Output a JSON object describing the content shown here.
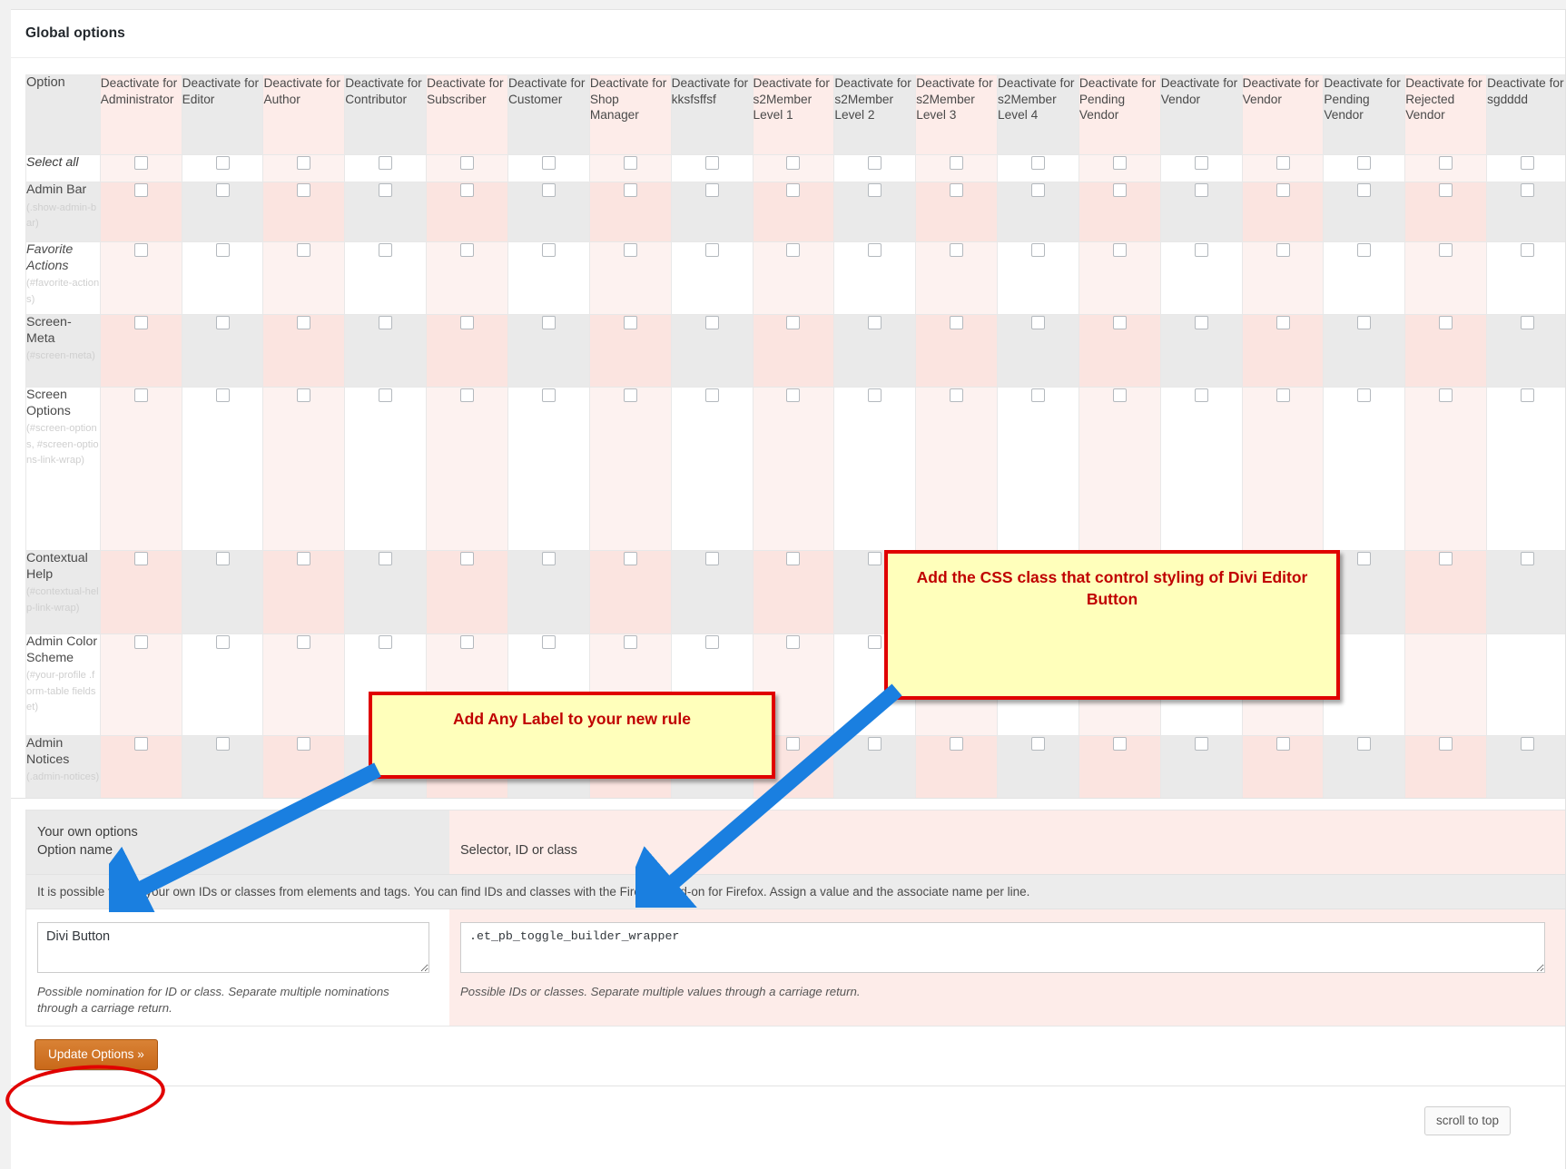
{
  "panel": {
    "title": "Global options"
  },
  "table": {
    "option_header": "Option",
    "columns": [
      "Deactivate for Administrator",
      "Deactivate for Editor",
      "Deactivate for Author",
      "Deactivate for Contributor",
      "Deactivate for Subscriber",
      "Deactivate for Customer",
      "Deactivate for Shop Manager",
      "Deactivate for kksfsffsf",
      "Deactivate for s2Member Level 1",
      "Deactivate for s2Member Level 2",
      "Deactivate for s2Member Level 3",
      "Deactivate for s2Member Level 4",
      "Deactivate for Pending Vendor",
      "Deactivate for Vendor",
      "Deactivate for Vendor",
      "Deactivate for Pending Vendor",
      "Deactivate for Rejected Vendor",
      "Deactivate for sgdddd"
    ],
    "rows": [
      {
        "label": "Select all",
        "selector": "",
        "style": "select-all"
      },
      {
        "label": "Admin Bar",
        "selector": "(.show-admin-bar)",
        "style": "normal"
      },
      {
        "label": "Favorite Actions",
        "selector": "(#favorite-actions)",
        "style": "italic"
      },
      {
        "label": "Screen-Meta",
        "selector": "(#screen-meta)",
        "style": "normal"
      },
      {
        "label": "Screen Options",
        "selector": "(#screen-options, #screen-options-link-wrap)",
        "style": "normal"
      },
      {
        "label": "Contextual Help",
        "selector": "(#contextual-help-link-wrap)",
        "style": "normal"
      },
      {
        "label": "Admin Color Scheme",
        "selector": "(#your-profile .form-table fieldset)",
        "style": "normal"
      },
      {
        "label": "Admin Notices",
        "selector": "(.admin-notices)",
        "style": "normal"
      }
    ]
  },
  "own_options": {
    "title_line1": "Your own options",
    "title_line2": "Option name",
    "selector_header": "Selector, ID or class",
    "note": "It is possible to add your own IDs or classes from elements and tags. You can find IDs and classes with the FireBug Add-on for Firefox. Assign a value and the associate name per line.",
    "option_name_value": "Divi Button",
    "option_name_placeholder": "",
    "selector_value": ".et_pb_toggle_builder_wrapper",
    "selector_placeholder": "",
    "hint_left": "Possible nomination for ID or class. Separate multiple nominations through a carriage return.",
    "hint_right": "Possible IDs or classes. Separate multiple values through a carriage return."
  },
  "buttons": {
    "update": "Update Options »",
    "scroll_top": "scroll to top"
  },
  "annotations": {
    "label_callout": "Add Any Label to your new rule",
    "css_callout": "Add the CSS class that control styling of Divi Editor Button"
  },
  "colors": {
    "callout_bg": "#ffffbb",
    "callout_border": "#e00000",
    "callout_text": "#c00000",
    "arrow": "#1a7fe0",
    "update_button": "#d2691e",
    "highlight_circle": "#e10000",
    "row_pink": "#fdece9",
    "row_gray": "#eaeaea"
  }
}
